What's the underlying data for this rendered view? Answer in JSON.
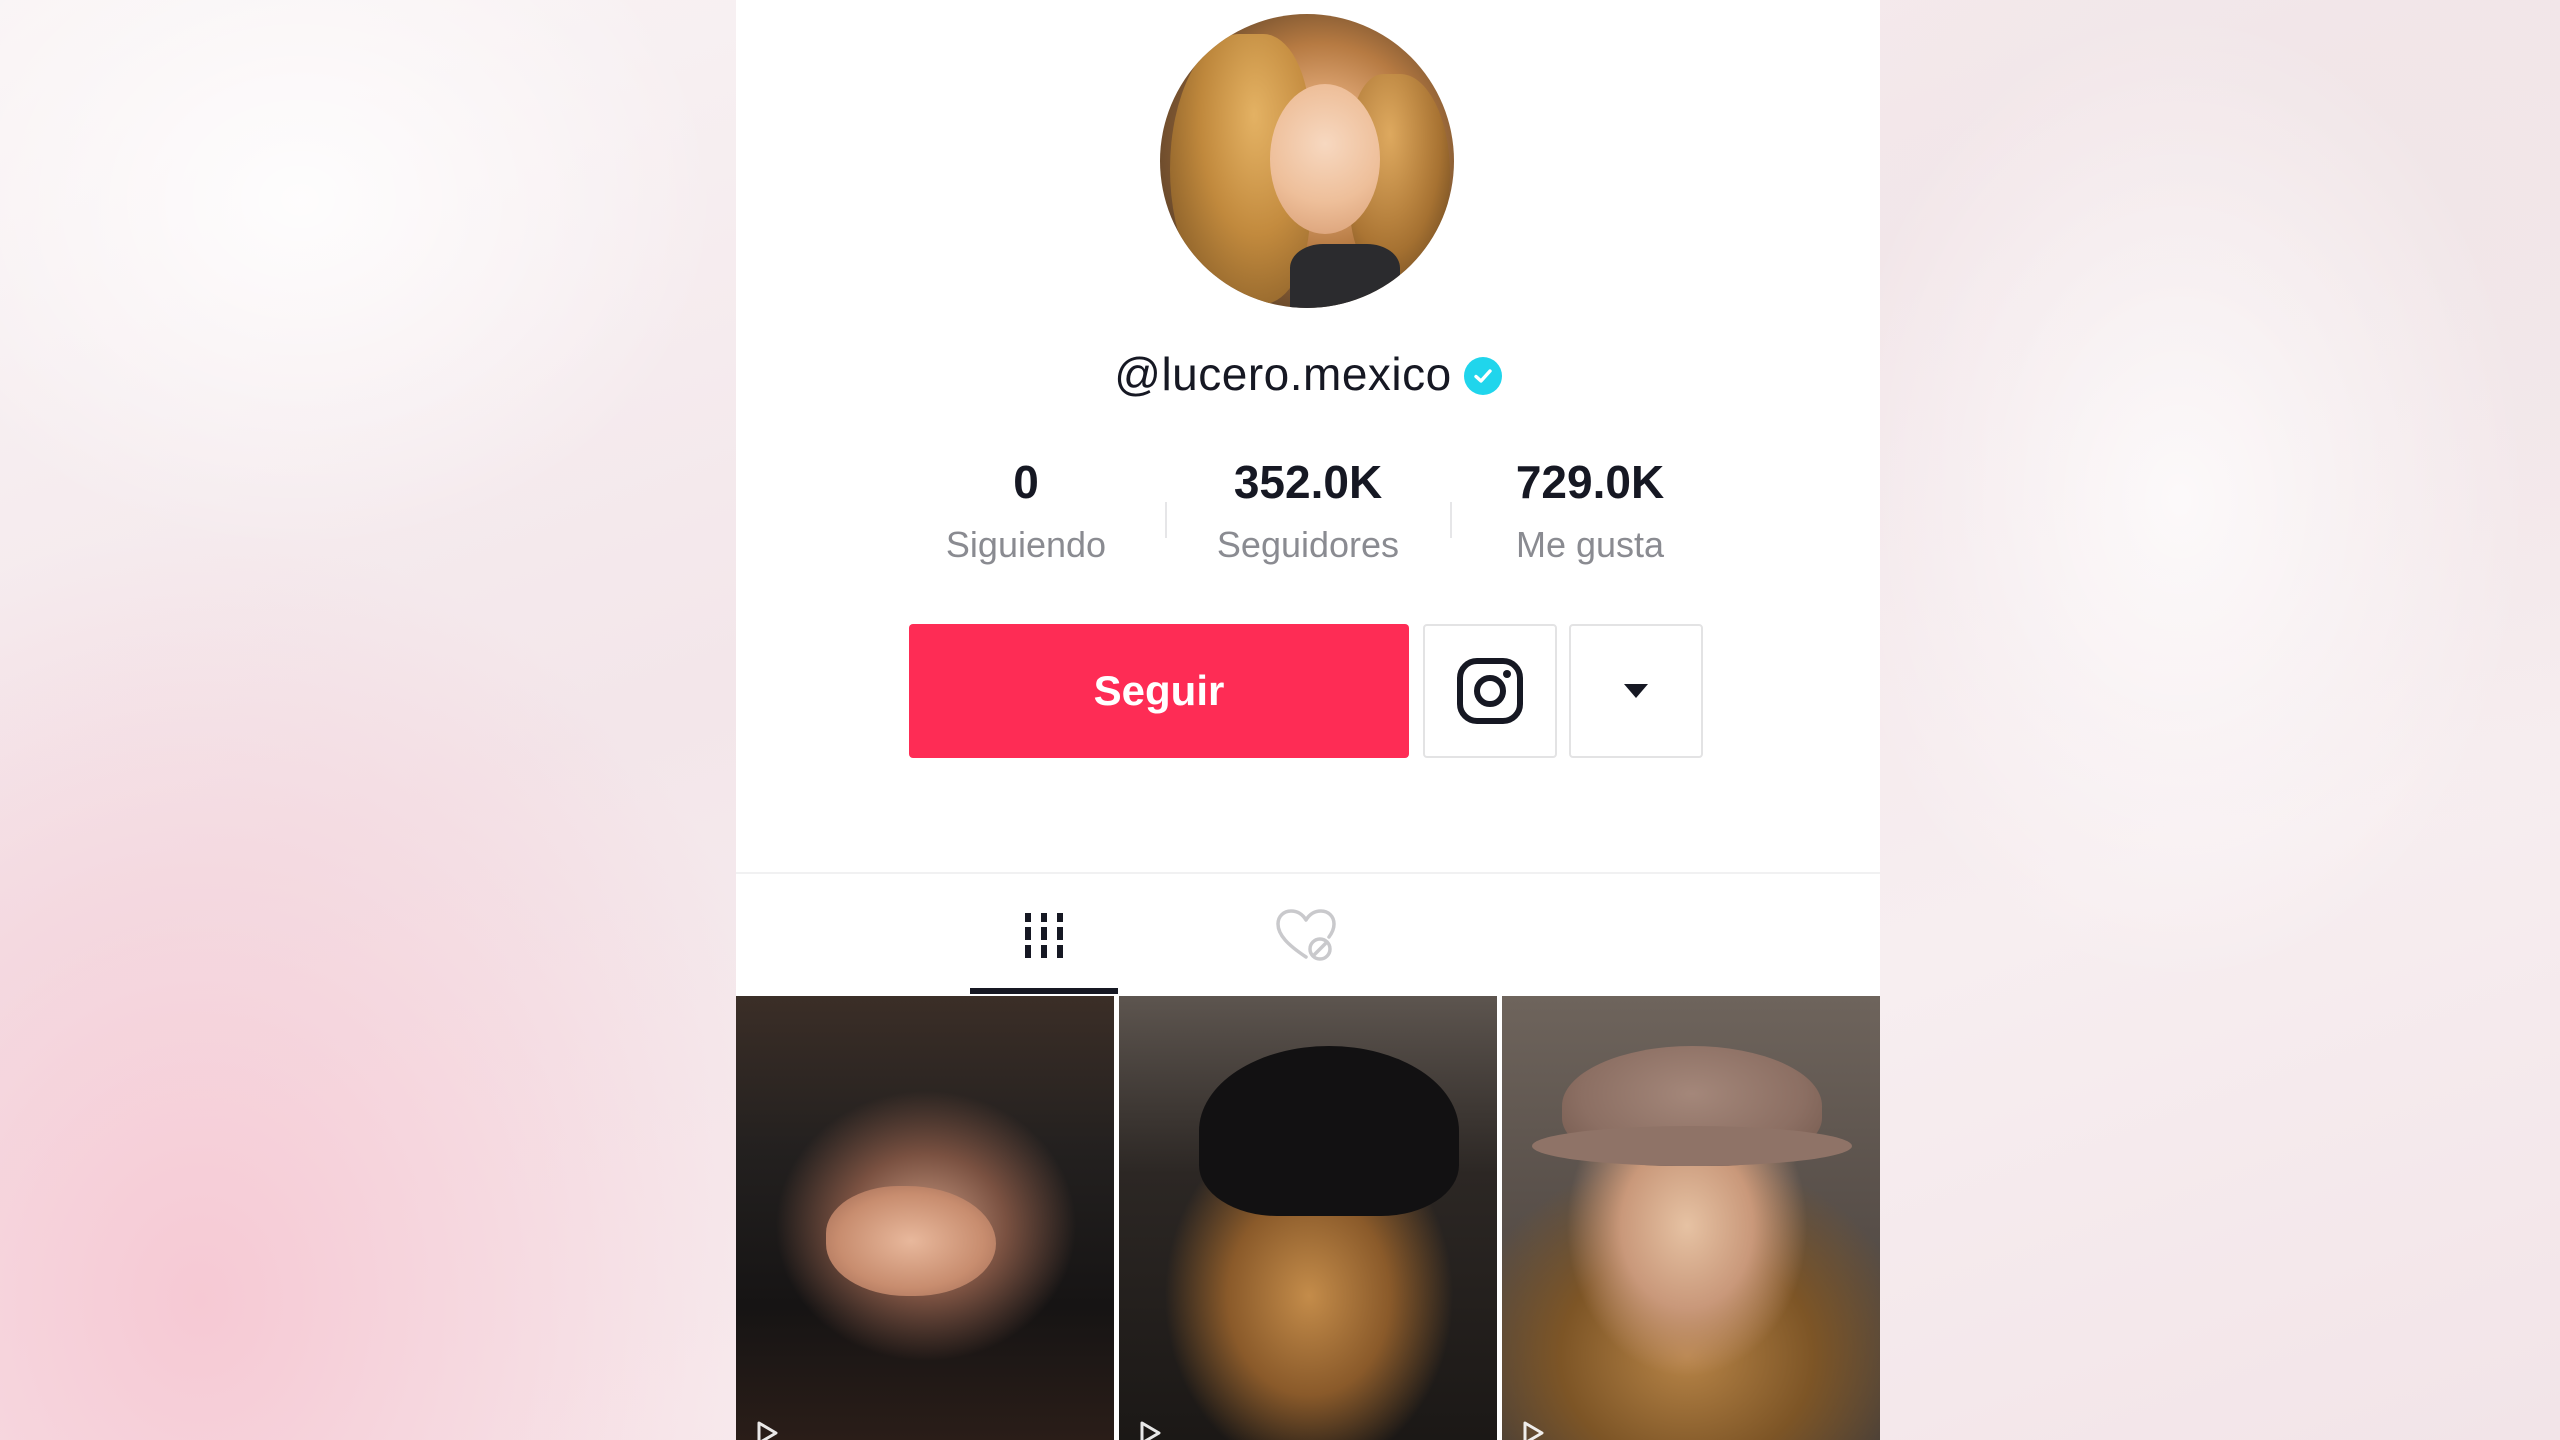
{
  "profile": {
    "username": "@lucero.mexico",
    "verified": true
  },
  "stats": [
    {
      "value": "0",
      "label": "Siguiendo"
    },
    {
      "value": "352.0K",
      "label": "Seguidores"
    },
    {
      "value": "729.0K",
      "label": "Me gusta"
    }
  ],
  "actions": {
    "follow_label": "Seguir",
    "instagram_icon": "instagram-icon",
    "more_icon": "caret-down-icon"
  },
  "tabs": [
    {
      "icon": "grid-videos-icon",
      "active": true
    },
    {
      "icon": "liked-hidden-icon",
      "active": false
    }
  ],
  "colors": {
    "accent": "#fe2c55",
    "verified": "#20d5ec",
    "text": "#161823",
    "muted": "#8a8b91"
  }
}
